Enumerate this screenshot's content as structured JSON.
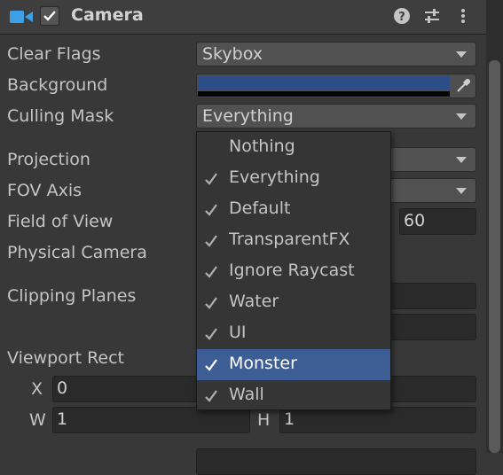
{
  "header": {
    "title": "Camera",
    "enabled": true
  },
  "rows": {
    "clear_flags": {
      "label": "Clear Flags",
      "value": "Skybox"
    },
    "background": {
      "label": "Background",
      "color": "#2d4d87"
    },
    "culling_mask": {
      "label": "Culling Mask",
      "value": "Everything"
    },
    "projection": {
      "label": "Projection"
    },
    "fov_axis": {
      "label": "FOV Axis"
    },
    "field_of_view": {
      "label": "Field of View",
      "value": "60"
    },
    "physical_camera": {
      "label": "Physical Camera"
    },
    "clipping_planes": {
      "label": "Clipping Planes"
    },
    "viewport_rect": {
      "label": "Viewport Rect",
      "x_label": "X",
      "x_value": "0",
      "w_label": "W",
      "w_value": "1",
      "h_label": "H",
      "h_value": "1"
    }
  },
  "culling_menu": {
    "items": [
      {
        "label": "Nothing",
        "checked": false
      },
      {
        "label": "Everything",
        "checked": true
      },
      {
        "label": "Default",
        "checked": true
      },
      {
        "label": "TransparentFX",
        "checked": true
      },
      {
        "label": "Ignore Raycast",
        "checked": true
      },
      {
        "label": "Water",
        "checked": true
      },
      {
        "label": "UI",
        "checked": true
      },
      {
        "label": "Monster",
        "checked": true,
        "highlighted": true
      },
      {
        "label": "Wall",
        "checked": true
      }
    ]
  },
  "icons": {
    "camera": "camera-icon",
    "help": "help-icon",
    "presets": "presets-icon",
    "more": "more-options-icon",
    "picker": "eyedropper-icon"
  },
  "colors": {
    "accent": "#3d5e94",
    "camera_icon": "#3f9fe6"
  }
}
